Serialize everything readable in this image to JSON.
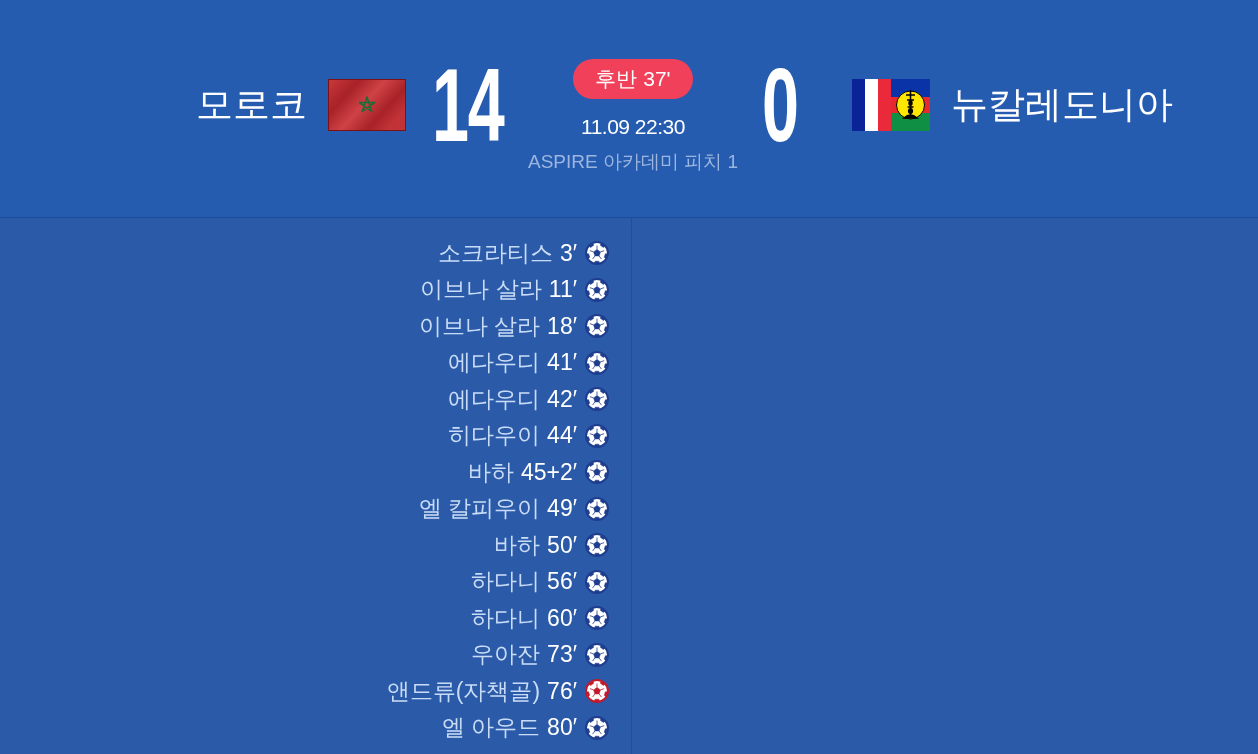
{
  "match": {
    "home": {
      "name": "모로코",
      "score": "14"
    },
    "status": "후반 37'",
    "datetime": "11.09 22:30",
    "venue": "ASPIRE 아카데미 피치 1",
    "away": {
      "score": "0",
      "name": "뉴칼레도니아"
    }
  },
  "home_goals": [
    {
      "player": "소크라티스",
      "minute": "3′",
      "kind": "goal"
    },
    {
      "player": "이브나 살라",
      "minute": "11′",
      "kind": "goal"
    },
    {
      "player": "이브나 살라",
      "minute": "18′",
      "kind": "goal"
    },
    {
      "player": "에다우디",
      "minute": "41′",
      "kind": "goal"
    },
    {
      "player": "에다우디",
      "minute": "42′",
      "kind": "goal"
    },
    {
      "player": "히다우이",
      "minute": "44′",
      "kind": "goal"
    },
    {
      "player": "바하",
      "minute": "45+2′",
      "kind": "goal"
    },
    {
      "player": "엘 칼피우이",
      "minute": "49′",
      "kind": "goal"
    },
    {
      "player": "바하",
      "minute": "50′",
      "kind": "goal"
    },
    {
      "player": "하다니",
      "minute": "56′",
      "kind": "goal"
    },
    {
      "player": "하다니",
      "minute": "60′",
      "kind": "goal"
    },
    {
      "player": "우아잔",
      "minute": "73′",
      "kind": "goal"
    },
    {
      "player": "앤드류(자책골)",
      "minute": "76′",
      "kind": "own_goal"
    },
    {
      "player": "엘 아우드",
      "minute": "80′",
      "kind": "goal"
    }
  ]
}
